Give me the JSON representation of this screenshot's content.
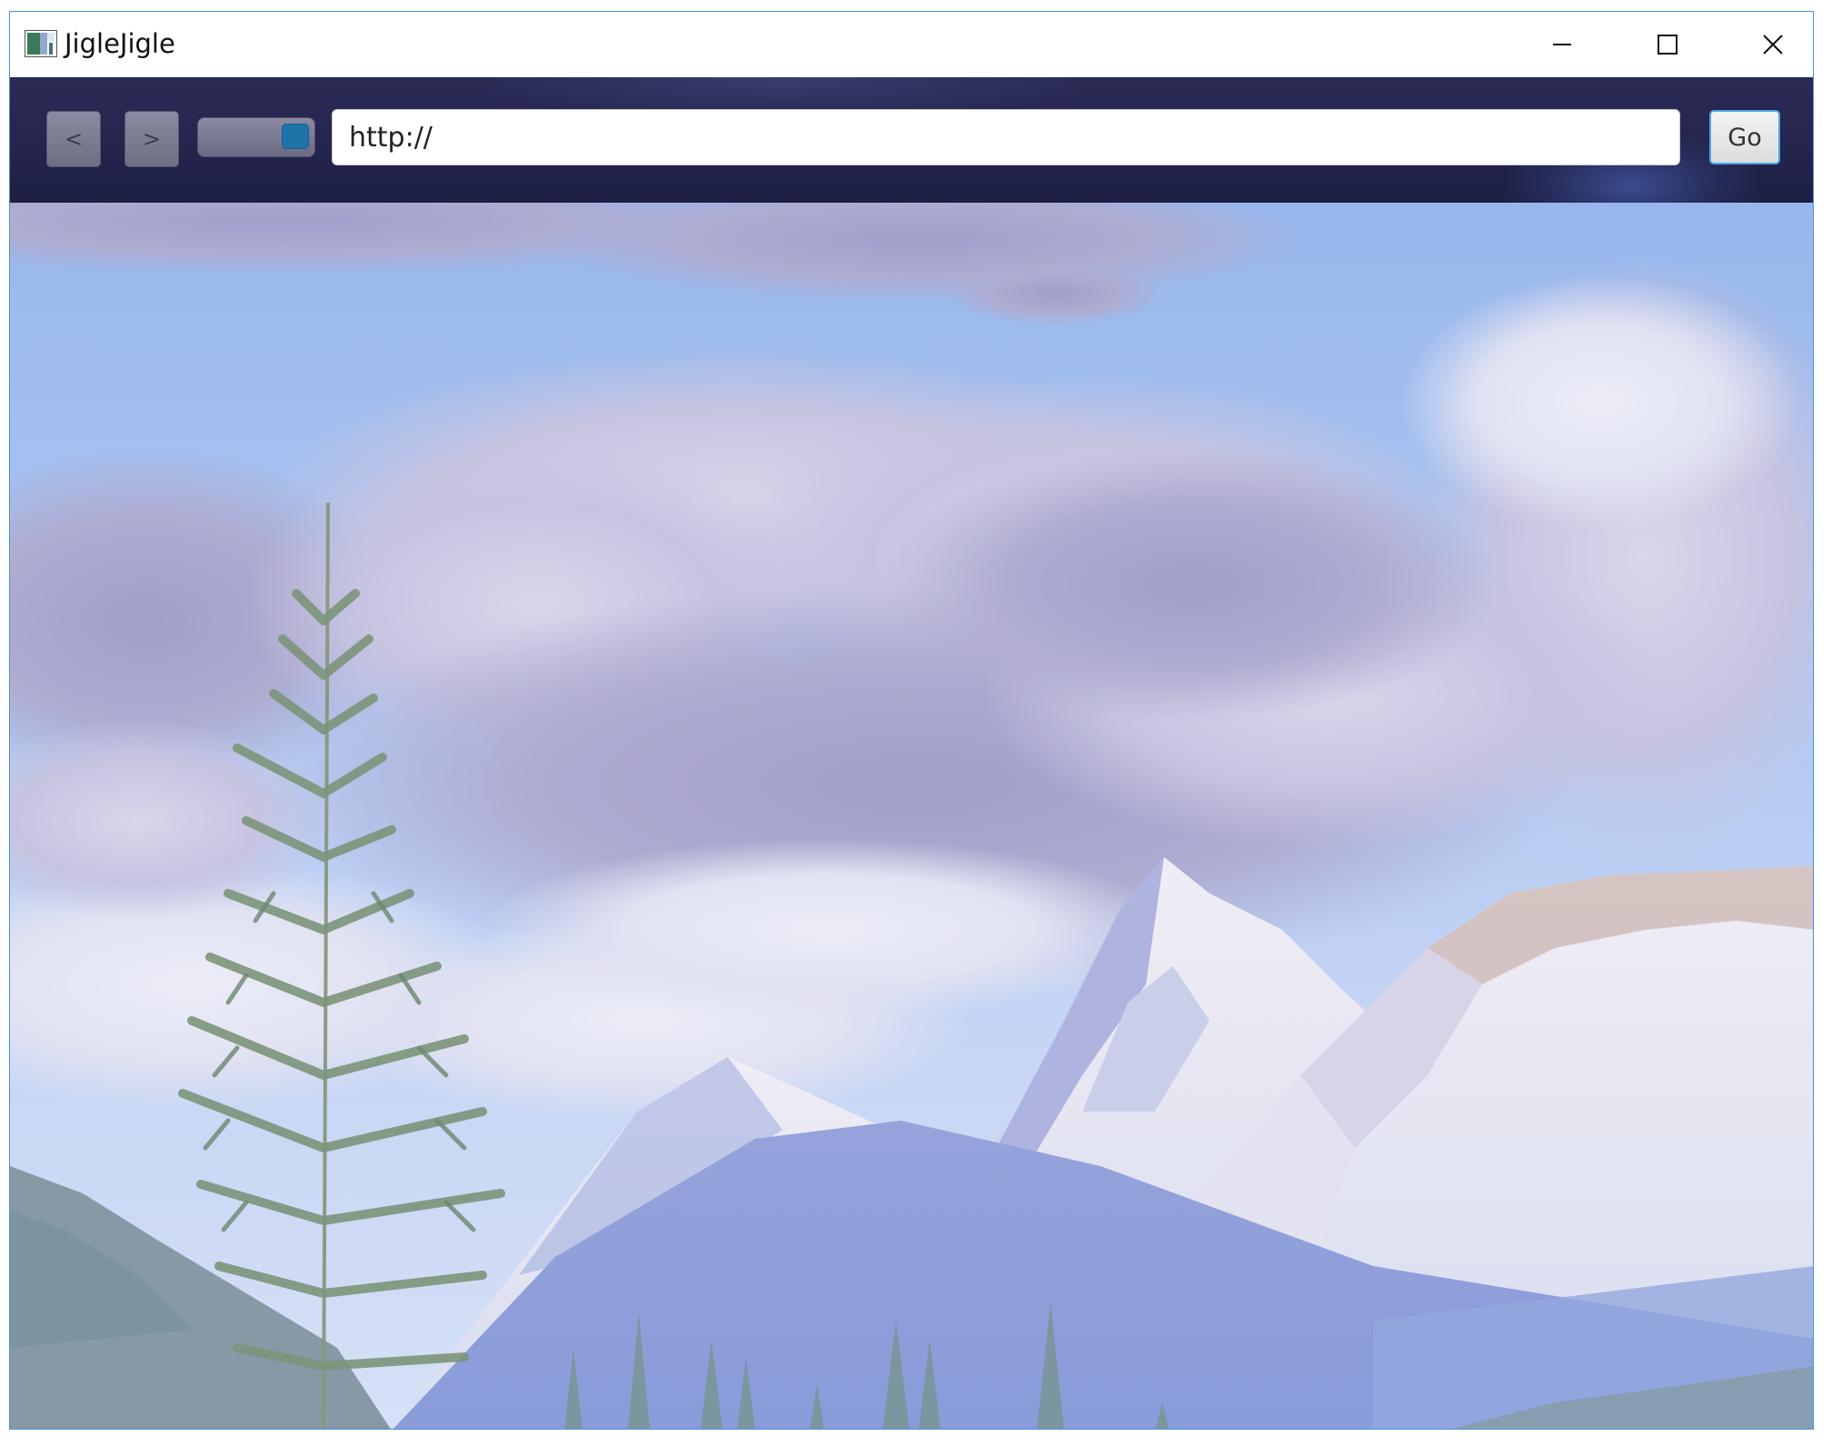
{
  "window": {
    "title": "JigleJigle",
    "app_icon": "app-icon",
    "controls": {
      "minimize_icon": "minimize-icon",
      "maximize_icon": "maximize-icon",
      "close_icon": "close-icon"
    }
  },
  "toolbar": {
    "back_label": "<",
    "forward_label": ">",
    "toggle": {
      "state": "on",
      "accent_color": "#1f73a8"
    },
    "url_value": "http://",
    "go_label": "Go"
  },
  "content": {
    "background_image": "mountain-landscape"
  },
  "colors": {
    "toolbar_bg": "#262650",
    "window_border": "#4a90e2",
    "go_focus_border": "#4aa6e8"
  }
}
